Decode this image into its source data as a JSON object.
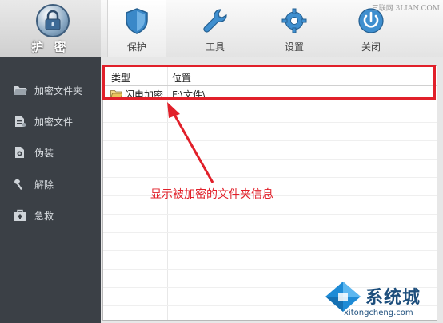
{
  "app": {
    "logo_label": "护 密",
    "tabs": [
      {
        "label": "保护",
        "icon": "shield-icon",
        "active": true
      },
      {
        "label": "工具",
        "icon": "wrench-icon",
        "active": false
      },
      {
        "label": "设置",
        "icon": "gear-icon",
        "active": false
      },
      {
        "label": "关闭",
        "icon": "power-icon",
        "active": false
      }
    ]
  },
  "watermark_top": "三联网 3LIAN.COM",
  "sidebar": {
    "items": [
      {
        "label": "加密文件夹",
        "icon": "folder-icon"
      },
      {
        "label": "加密文件",
        "icon": "file-icon"
      },
      {
        "label": "伪装",
        "icon": "disguise-icon"
      },
      {
        "label": "解除",
        "icon": "unlock-icon"
      },
      {
        "label": "急救",
        "icon": "first-aid-icon"
      }
    ]
  },
  "list": {
    "headers": {
      "type": "类型",
      "location": "位置"
    },
    "rows": [
      {
        "type": "闪电加密",
        "location": "F:\\文件\\"
      }
    ]
  },
  "annotation": {
    "text": "显示被加密的文件夹信息",
    "color": "#e1202a"
  },
  "watermark": {
    "title": "系统城",
    "url": "xitongcheng.com"
  }
}
